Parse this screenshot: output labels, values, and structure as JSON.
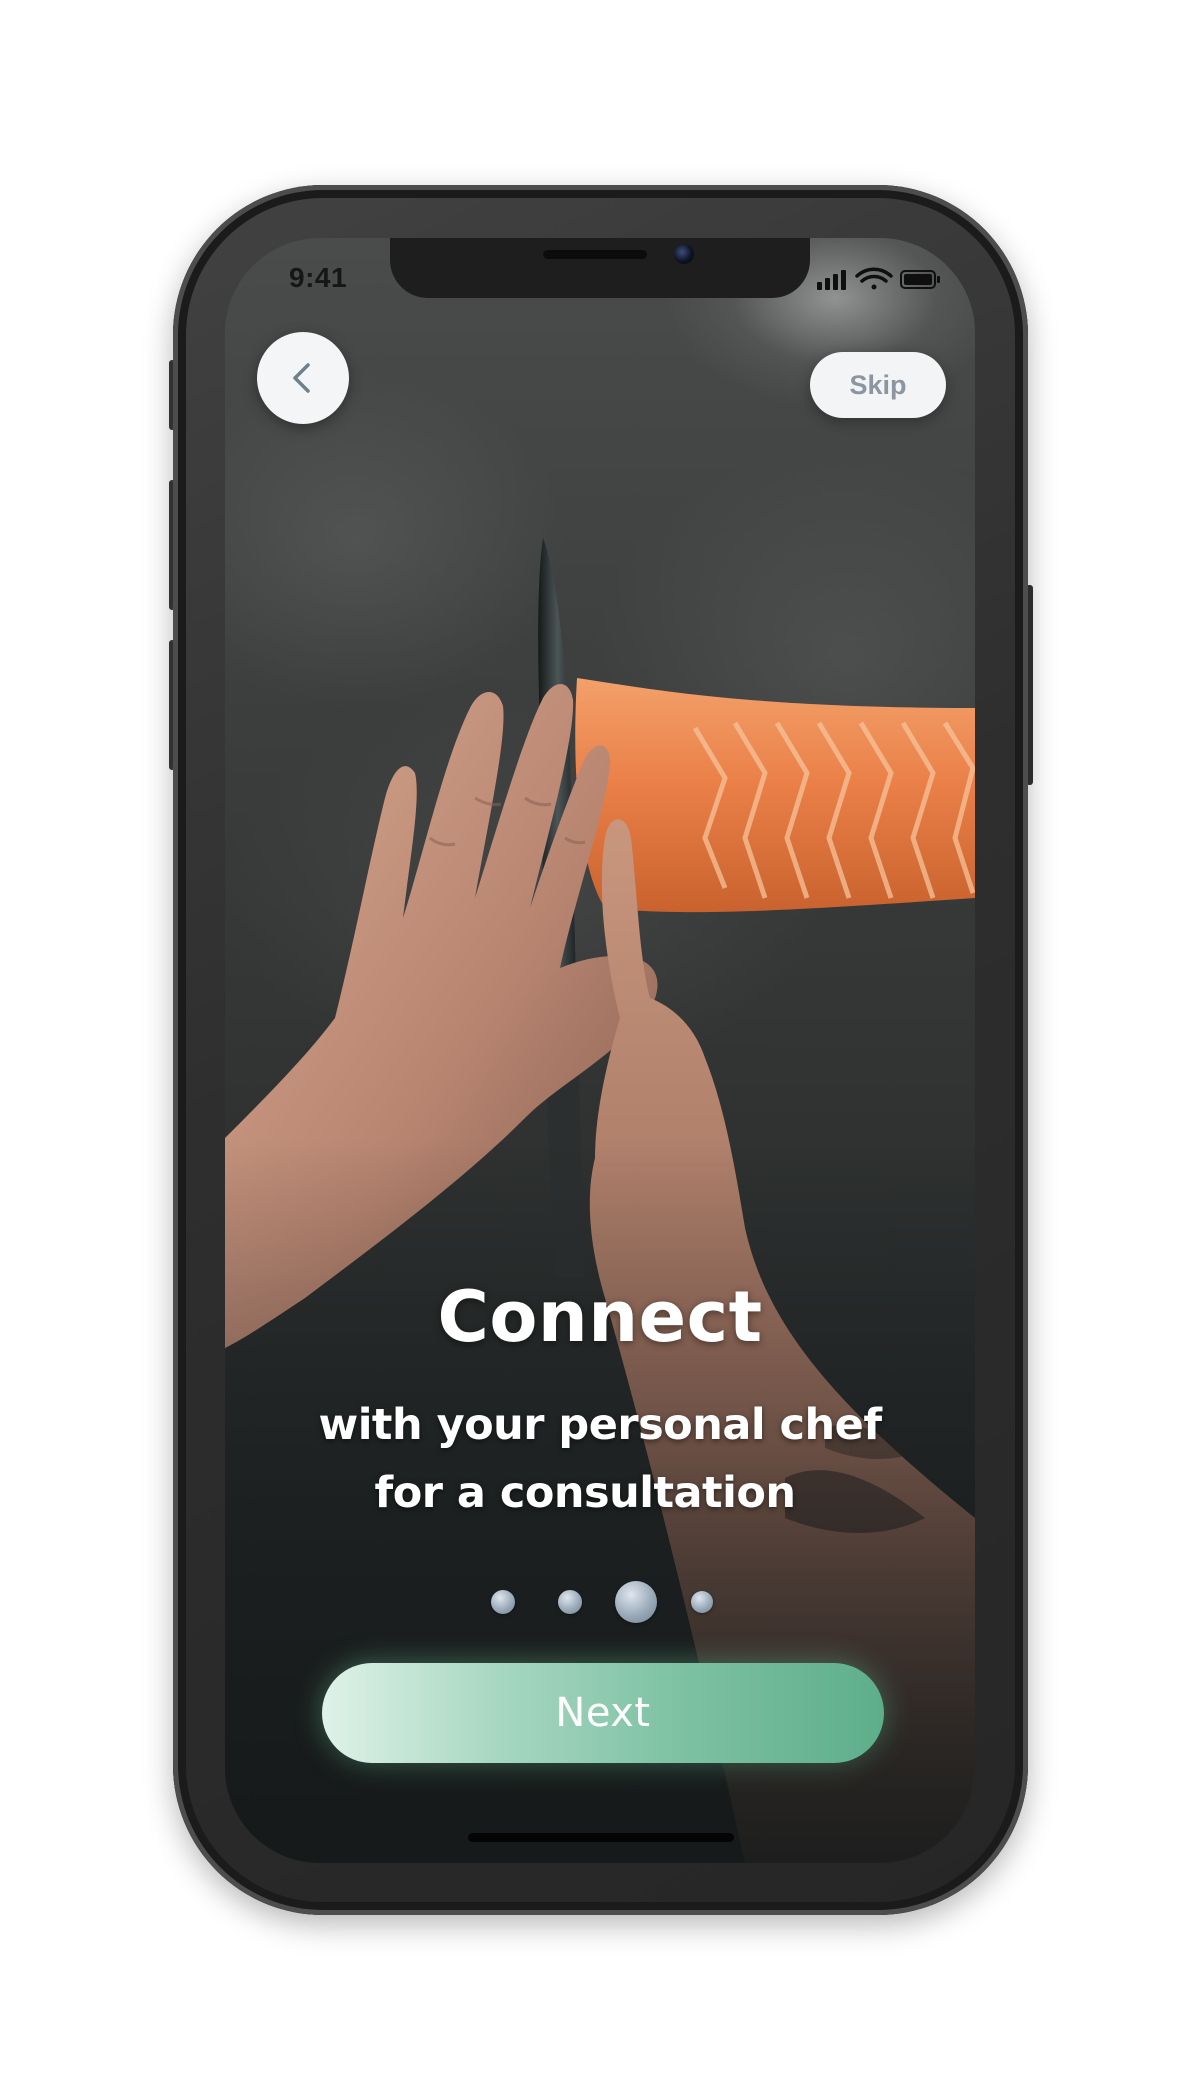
{
  "status_bar": {
    "time": "9:41",
    "icons": [
      "signal-icon",
      "wifi-icon",
      "battery-icon"
    ]
  },
  "nav": {
    "back_icon": "chevron-left-icon",
    "skip_label": "Skip"
  },
  "onboarding": {
    "title": "Connect",
    "subtitle_line1": "with your personal chef",
    "subtitle_line2": "for a consultation",
    "page_count": 4,
    "current_page": 3
  },
  "cta": {
    "next_label": "Next"
  },
  "colors": {
    "accent_green": "#5eae8a",
    "button_light": "#f3f4f5",
    "skip_text": "#8c96a0"
  }
}
